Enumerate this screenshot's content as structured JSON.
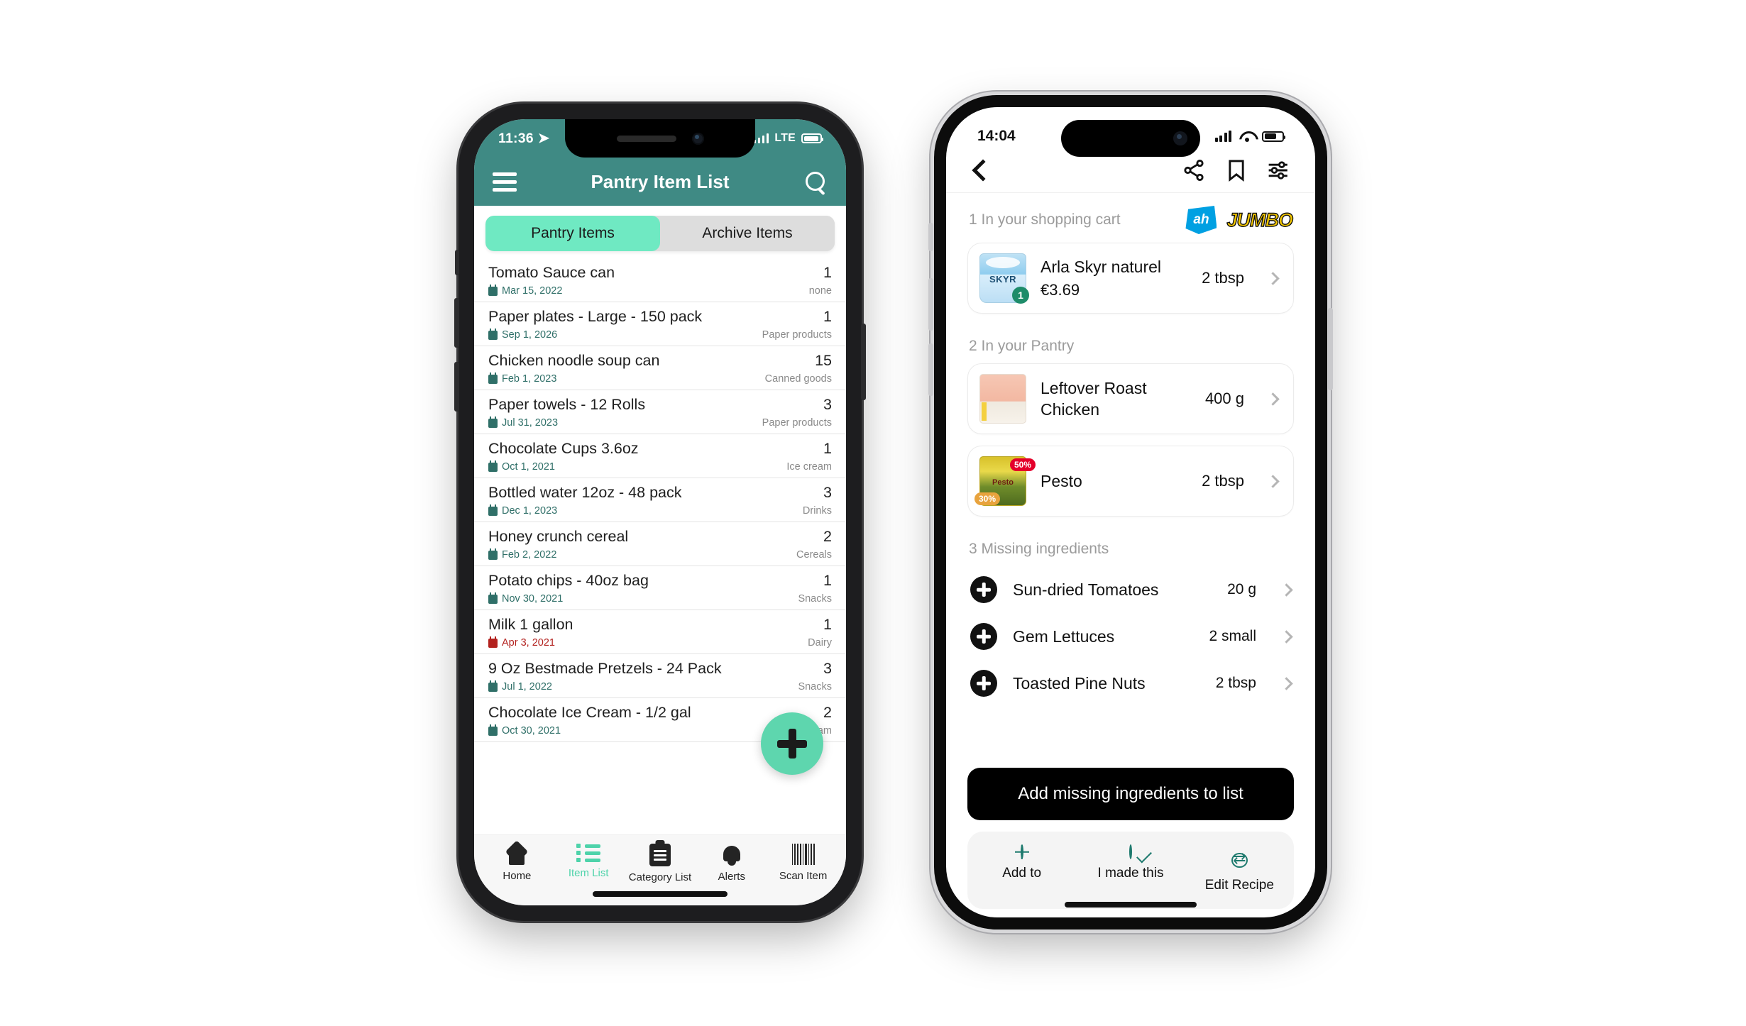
{
  "left_phone": {
    "status": {
      "time": "11:36",
      "location_icon": "location-arrow-icon",
      "network": "LTE"
    },
    "navbar": {
      "menu_icon": "hamburger-menu-icon",
      "title": "Pantry Item List",
      "search_icon": "search-icon"
    },
    "segment": {
      "active": "Pantry Items",
      "inactive": "Archive Items"
    },
    "items": [
      {
        "name": "Chocolate Ice Cream - 1/2 gal",
        "qty": "2",
        "date": "Oct 30, 2021",
        "category": "Ice cream",
        "expired": false
      },
      {
        "name": "9 Oz Bestmade Pretzels - 24 Pack",
        "qty": "3",
        "date": "Jul 1, 2022",
        "category": "Snacks",
        "expired": false
      },
      {
        "name": "Milk 1 gallon",
        "qty": "1",
        "date": "Apr 3, 2021",
        "category": "Dairy",
        "expired": true
      },
      {
        "name": "Potato chips - 40oz bag",
        "qty": "1",
        "date": "Nov 30, 2021",
        "category": "Snacks",
        "expired": false
      },
      {
        "name": "Honey crunch cereal",
        "qty": "2",
        "date": "Feb 2, 2022",
        "category": "Cereals",
        "expired": false
      },
      {
        "name": "Bottled water 12oz - 48 pack",
        "qty": "3",
        "date": "Dec 1, 2023",
        "category": "Drinks",
        "expired": false
      },
      {
        "name": "Chocolate Cups 3.6oz",
        "qty": "1",
        "date": "Oct 1, 2021",
        "category": "Ice cream",
        "expired": false
      },
      {
        "name": "Paper towels - 12 Rolls",
        "qty": "3",
        "date": "Jul 31, 2023",
        "category": "Paper products",
        "expired": false
      },
      {
        "name": "Chicken noodle soup can",
        "qty": "15",
        "date": "Feb 1, 2023",
        "category": "Canned goods",
        "expired": false
      },
      {
        "name": "Paper plates - Large - 150 pack",
        "qty": "1",
        "date": "Sep 1, 2026",
        "category": "Paper products",
        "expired": false
      },
      {
        "name": "Tomato Sauce can",
        "qty": "1",
        "date": "Mar 15, 2022",
        "category": "none",
        "expired": false
      }
    ],
    "fab": {
      "icon": "plus-icon"
    },
    "tabbar": [
      {
        "label": "Home",
        "icon": "home-icon",
        "active": false
      },
      {
        "label": "Item List",
        "icon": "list-icon",
        "active": true
      },
      {
        "label": "Category List",
        "icon": "clipboard-icon",
        "active": false
      },
      {
        "label": "Alerts",
        "icon": "bell-icon",
        "active": false
      },
      {
        "label": "Scan Item",
        "icon": "barcode-icon",
        "active": false
      }
    ],
    "colors": {
      "header": "#3F8A84",
      "accent": "#4ED3AA",
      "segment_active": "#6FE9C2",
      "expired": "#B3221F"
    }
  },
  "right_phone": {
    "status": {
      "time": "14:04"
    },
    "navbar": {
      "back_icon": "chevron-left-icon",
      "share_icon": "share-icon",
      "bookmark_icon": "bookmark-icon",
      "settings_icon": "sliders-icon"
    },
    "cart_section": {
      "heading": "1 In your shopping cart",
      "store_logos": [
        {
          "name": "ah-logo",
          "text": "ah",
          "color": "#00A0E2"
        },
        {
          "name": "jumbo-logo",
          "text": "JUMBO",
          "color": "#F5C800"
        }
      ],
      "items": [
        {
          "name": "Arla Skyr naturel",
          "price": "€3.69",
          "amount": "2 tbsp",
          "badge": "1",
          "thumb": "skyr-yogurt-thumbnail"
        }
      ]
    },
    "pantry_section": {
      "heading": "2 In your Pantry",
      "items": [
        {
          "name": "Leftover Roast Chicken",
          "amount": "400 g",
          "thumb": "raw-chicken-thumbnail",
          "discounts": []
        },
        {
          "name": "Pesto",
          "amount": "2 tbsp",
          "thumb": "pesto-jar-thumbnail",
          "discounts": [
            {
              "label": "50%",
              "color": "#E4002B"
            },
            {
              "label": "30%",
              "color": "#E8A33D"
            }
          ]
        }
      ]
    },
    "missing_section": {
      "heading": "3 Missing ingredients",
      "items": [
        {
          "name": "Sun-dried Tomatoes",
          "amount": "20 g",
          "icon": "plus-circle-icon"
        },
        {
          "name": "Gem Lettuces",
          "amount": "2 small",
          "icon": "plus-circle-icon"
        },
        {
          "name": "Toasted Pine Nuts",
          "amount": "2 tbsp",
          "icon": "plus-circle-icon"
        }
      ]
    },
    "cta": {
      "label": "Add missing ingredients to list"
    },
    "footer_actions": [
      {
        "label": "Add to",
        "icon": "plus-circle-outline-icon"
      },
      {
        "label": "I made this",
        "icon": "check-circle-outline-icon"
      },
      {
        "label": "Edit Recipe",
        "icon": "shuffle-circle-icon"
      }
    ],
    "colors": {
      "accent": "#1E7A6E",
      "cta_bg": "#000000"
    }
  }
}
